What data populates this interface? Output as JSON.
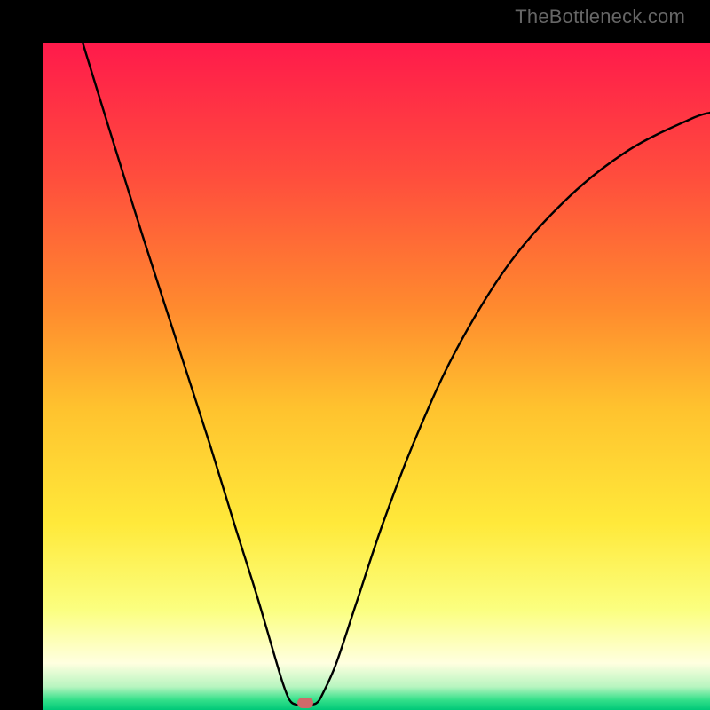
{
  "watermark": "TheBottleneck.com",
  "chart_data": {
    "type": "line",
    "title": "",
    "xlabel": "",
    "ylabel": "",
    "xlim": [
      0,
      1
    ],
    "ylim": [
      0,
      1
    ],
    "background": {
      "type": "vertical-gradient",
      "stops": [
        {
          "pos": 0.0,
          "color": "#ff1a4b"
        },
        {
          "pos": 0.2,
          "color": "#ff4d3d"
        },
        {
          "pos": 0.4,
          "color": "#ff8b2e"
        },
        {
          "pos": 0.55,
          "color": "#ffc32e"
        },
        {
          "pos": 0.72,
          "color": "#ffe93a"
        },
        {
          "pos": 0.85,
          "color": "#fbff80"
        },
        {
          "pos": 0.93,
          "color": "#ffffe0"
        },
        {
          "pos": 0.965,
          "color": "#b8f5c0"
        },
        {
          "pos": 0.985,
          "color": "#34e08a"
        },
        {
          "pos": 1.0,
          "color": "#00c878"
        }
      ]
    },
    "series": [
      {
        "name": "bottleneck-curve",
        "x": [
          0.06,
          0.1,
          0.15,
          0.2,
          0.25,
          0.29,
          0.32,
          0.345,
          0.36,
          0.37,
          0.38,
          0.395,
          0.41,
          0.42,
          0.44,
          0.47,
          0.51,
          0.56,
          0.62,
          0.7,
          0.79,
          0.88,
          0.97,
          1.0
        ],
        "y": [
          1.0,
          0.87,
          0.71,
          0.555,
          0.4,
          0.27,
          0.175,
          0.09,
          0.04,
          0.015,
          0.008,
          0.008,
          0.01,
          0.025,
          0.07,
          0.16,
          0.28,
          0.41,
          0.54,
          0.67,
          0.77,
          0.84,
          0.885,
          0.895
        ]
      }
    ],
    "minimum_marker": {
      "x": 0.394,
      "y": 0.01,
      "color": "#cf6a6a"
    }
  }
}
